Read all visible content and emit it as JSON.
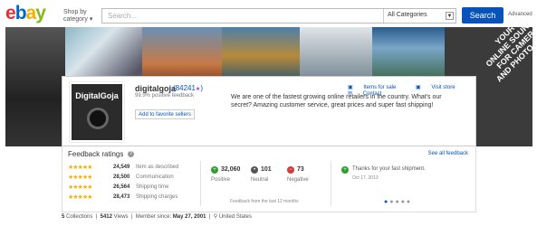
{
  "header": {
    "logo": {
      "e": "e",
      "b": "b",
      "a": "a",
      "y": "y"
    },
    "shop_by_line1": "Shop by",
    "shop_by_line2": "category",
    "search_placeholder": "Search...",
    "category_select": "All Categories",
    "search_button": "Search",
    "advanced_link": "Advanced"
  },
  "banner": {
    "ribbon_lines": [
      "YOUR",
      "ONLINE SOURCE",
      "FOR CAMERA",
      "AND PHOTO GEAR"
    ]
  },
  "profile": {
    "avatar_title": "DigitalGoja",
    "username": "digitalgoja",
    "score": "(84241",
    "score_star": "★",
    "score_close": ")",
    "positive_pct": "99.9% positive feedback",
    "add_favorite": "Add to favorite sellers",
    "links": [
      "Items for sale",
      "Visit store",
      "Contact"
    ],
    "description": "We are one of the fastest growing online retailers in the country. What's our secret? Amazing customer service, great prices and super fast shipping!"
  },
  "feedback": {
    "title": "Feedback ratings",
    "info_icon": "?",
    "see_all": "See all feedback",
    "ratings": [
      {
        "stars": "★★★★★",
        "count": "24,549",
        "label": "Item as described"
      },
      {
        "stars": "★★★★★",
        "count": "28,500",
        "label": "Communication"
      },
      {
        "stars": "★★★★★",
        "count": "26,564",
        "label": "Shipping time"
      },
      {
        "stars": "★★★★★",
        "count": "28,473",
        "label": "Shipping charges"
      }
    ],
    "summary": [
      {
        "count": "32,060",
        "label": "Positive",
        "color": "#2e9e2e",
        "sign": "+"
      },
      {
        "count": "101",
        "label": "Neutral",
        "color": "#555555",
        "sign": "•"
      },
      {
        "count": "73",
        "label": "Negative",
        "color": "#d43b3b",
        "sign": "−"
      }
    ],
    "period_note": "Feedback from the last 12 months",
    "latest": {
      "text": "Thanks for your fast shipment.",
      "date": "Oct 17, 2013",
      "sign": "+",
      "color": "#2e9e2e"
    },
    "pager_active": "●",
    "pager_rest": "●●●●"
  },
  "footer": {
    "collections": "5",
    "collections_label": "Collections",
    "views": "5412",
    "views_label": "Views",
    "member_label": "Member since:",
    "member_since": "May 27, 2001",
    "location": "United States"
  },
  "colors": {
    "ebay_red": "#e53238",
    "ebay_blue": "#0064d2",
    "ebay_yellow": "#f5af02",
    "ebay_green": "#86b817",
    "link": "#0654ba",
    "star": "#f5af02"
  }
}
